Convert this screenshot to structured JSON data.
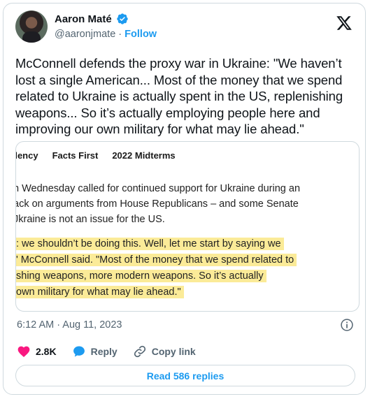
{
  "author": {
    "name": "Aaron Maté",
    "handle": "@aaronjmate",
    "separator": "·",
    "follow_label": "Follow"
  },
  "tweet": {
    "text": "McConnell defends the proxy war in Ukraine: \"We haven’t lost a single American... Most of the money that we spend related to Ukraine is actually spent in the US, replenishing weapons... So it’s actually employing people here and improving our own military for what may lie ahead.\""
  },
  "embed": {
    "nav": [
      "dency",
      "Facts First",
      "2022 Midterms"
    ],
    "article_lines": [
      "n Wednesday called for continued support for Ukraine during an",
      "ack on arguments from House Republicans – and some Senate",
      "Jkraine is not an issue for the US."
    ],
    "quote_lines": [
      ": we shouldn’t be doing this. Well, let me start by saying we",
      "' McConnell said. \"Most of the money that we spend related to",
      "shing weapons, more modern weapons. So it’s actually",
      "own military for what may lie ahead.\""
    ]
  },
  "meta": {
    "timestamp": "6:12 AM · Aug 11, 2023"
  },
  "actions": {
    "likes": "2.8K",
    "reply_label": "Reply",
    "copy_link_label": "Copy link"
  },
  "read_replies_label": "Read 586 replies",
  "colors": {
    "accent": "#1d9bf0",
    "like": "#f91880",
    "highlight": "#fbeb98"
  }
}
